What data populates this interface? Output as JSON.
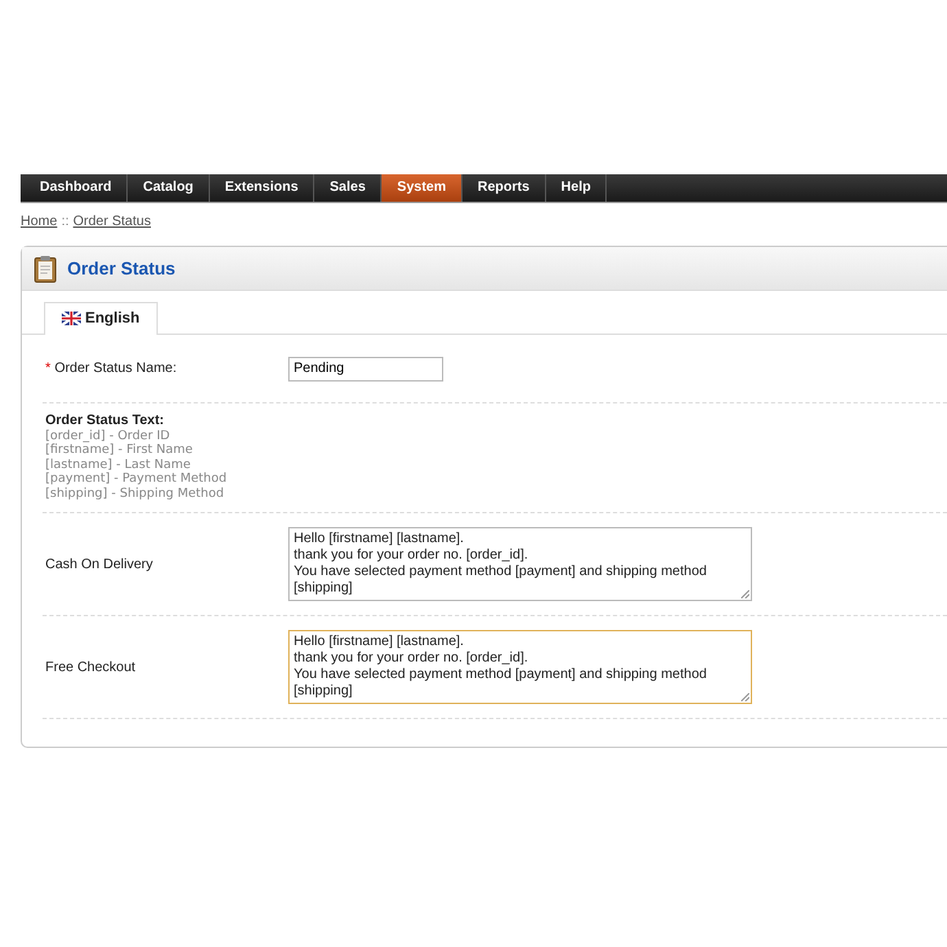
{
  "menu": [
    {
      "label": "Dashboard",
      "selected": false
    },
    {
      "label": "Catalog",
      "selected": false
    },
    {
      "label": "Extensions",
      "selected": false
    },
    {
      "label": "Sales",
      "selected": false
    },
    {
      "label": "System",
      "selected": true
    },
    {
      "label": "Reports",
      "selected": false
    },
    {
      "label": "Help",
      "selected": false
    }
  ],
  "breadcrumb": [
    "Home",
    "Order Status"
  ],
  "breadcrumb_separator": "::",
  "panel": {
    "title": "Order Status",
    "tabs": [
      {
        "label": "English",
        "selected": true
      }
    ],
    "name_field": {
      "required_mark": "*",
      "label": "Order Status Name:",
      "value": "Pending"
    },
    "help": {
      "title": "Order Status Text:",
      "lines": [
        "[order_id] - Order ID",
        "[firstname] - First Name",
        "[lastname] - Last Name",
        "[payment] - Payment Method",
        "[shipping] - Shipping Method"
      ]
    },
    "messages": [
      {
        "label": "Cash On Delivery",
        "focused": false,
        "lines": [
          "Hello [firstname] [lastname].",
          "thank you for your order no. [order_id].",
          "You have selected payment method [payment] and shipping method",
          "[shipping]"
        ]
      },
      {
        "label": "Free Checkout",
        "focused": true,
        "lines": [
          "Hello [firstname] [lastname].",
          "thank you for your order no. [order_id].",
          "You have selected payment method [payment] and shipping method",
          "[shipping]"
        ]
      }
    ]
  }
}
